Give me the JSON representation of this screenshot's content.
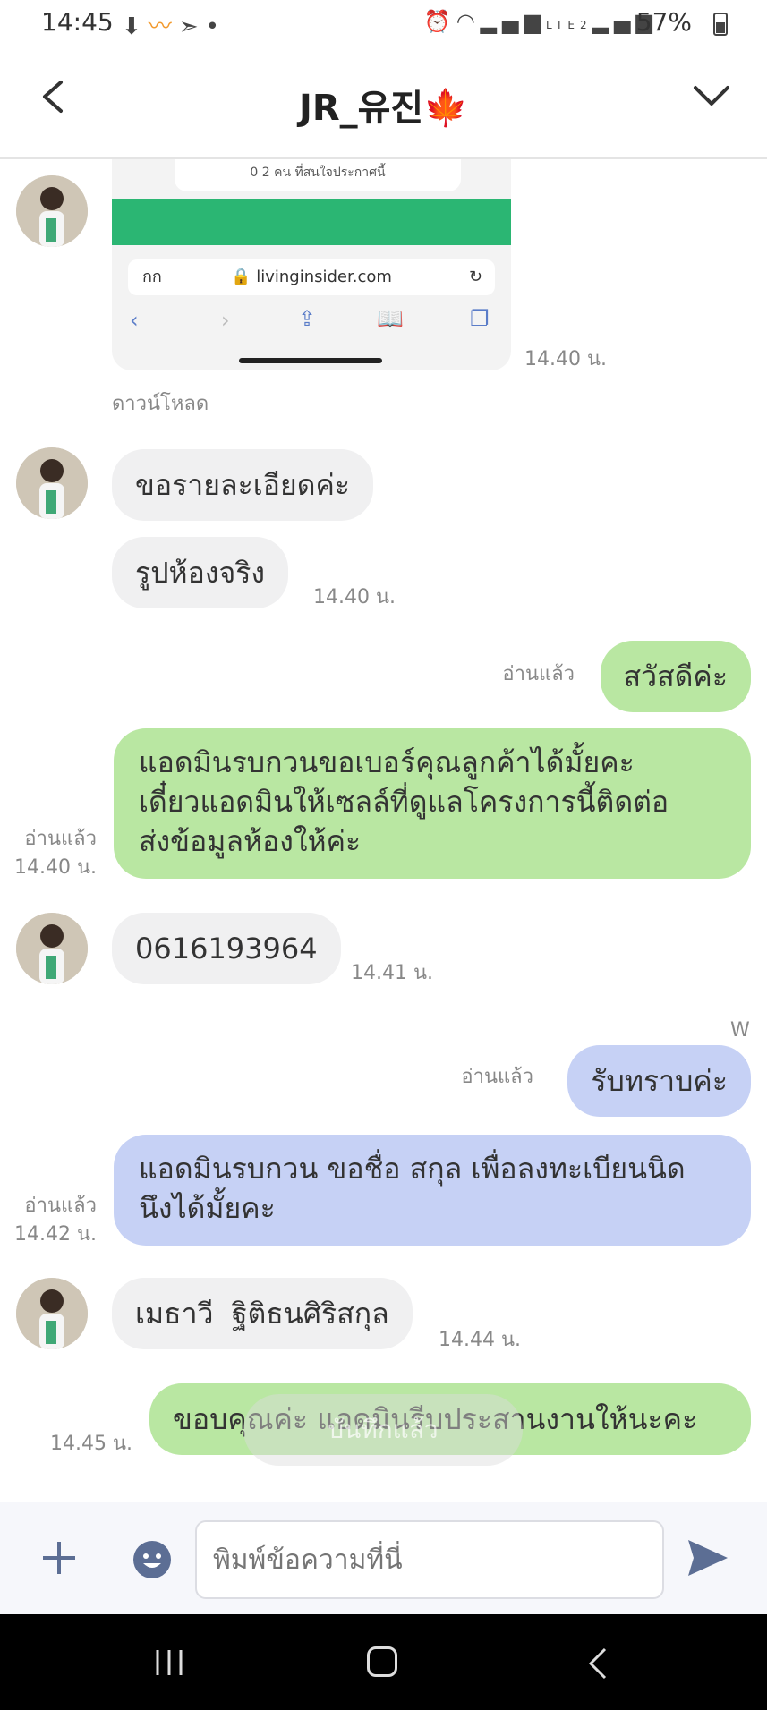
{
  "status_bar": {
    "time": "14:45",
    "battery": "57%",
    "left_icons": [
      "download-icon",
      "app-icon",
      "send-icon",
      "dot-icon"
    ],
    "right_icons": [
      "alarm-icon",
      "wifi-icon",
      "signal-icon",
      "volte-icon",
      "signal-icon"
    ]
  },
  "header": {
    "title": "JR_유진🍁",
    "back_icon": "chevron-left-icon",
    "menu_icon": "chevron-down-icon"
  },
  "messages": [
    {
      "type": "image",
      "from": "contact",
      "time": "14.40 น.",
      "download_label": "ดาวน์โหลด",
      "image_text": {
        "top": "0 2 คน ที่สนใจประกาศนี้",
        "url": "livinginsider.com",
        "url_left": "กก"
      }
    },
    {
      "type": "text",
      "from": "contact",
      "text": "ขอรายละเอียดค่ะ"
    },
    {
      "type": "text",
      "from": "contact",
      "text": "รูปห้องจริง",
      "time": "14.40 น."
    },
    {
      "type": "text",
      "from": "me",
      "color": "green",
      "text": "สวัสดีค่ะ",
      "read": "อ่านแล้ว"
    },
    {
      "type": "text",
      "from": "me",
      "color": "green",
      "lines": [
        "แอดมินรบกวนขอเบอร์คุณลูกค้าได้มั้ยคะ",
        "เดี๋ยวแอดมินให้เซลล์ที่ดูแลโครงการนี้ติดต่อ",
        "ส่งข้อมูลห้องให้ค่ะ"
      ],
      "read": "อ่านแล้ว",
      "time": "14.40 น."
    },
    {
      "type": "text",
      "from": "contact",
      "text": "0616193964",
      "time": "14.41 น."
    },
    {
      "type": "marker",
      "text": "W"
    },
    {
      "type": "text",
      "from": "me",
      "color": "blue",
      "text": "รับทราบค่ะ",
      "read": "อ่านแล้ว"
    },
    {
      "type": "text",
      "from": "me",
      "color": "blue",
      "lines": [
        "แอดมินรบกวน ขอชื่อ สกุล เพื่อลงทะเบียนนิด",
        "นึงได้มั้ยคะ"
      ],
      "read": "อ่านแล้ว",
      "time": "14.42 น."
    },
    {
      "type": "text",
      "from": "contact",
      "text": "เมธาวี  ฐิติธนศิริสกุล",
      "time": "14.44 น."
    },
    {
      "type": "text",
      "from": "me",
      "color": "green",
      "text": "ขอบคุณค่ะ แอดมินรีบประสานงานให้นะคะ",
      "time": "14.45 น."
    }
  ],
  "toast": "บันทึกแล้ว",
  "input": {
    "placeholder": "พิมพ์ข้อความที่นี่"
  },
  "colors": {
    "green_bubble": "#b9e7a2",
    "blue_bubble": "#c6d1f5",
    "incoming_bubble": "#f0f0f1",
    "send_icon": "#5c6e94"
  }
}
